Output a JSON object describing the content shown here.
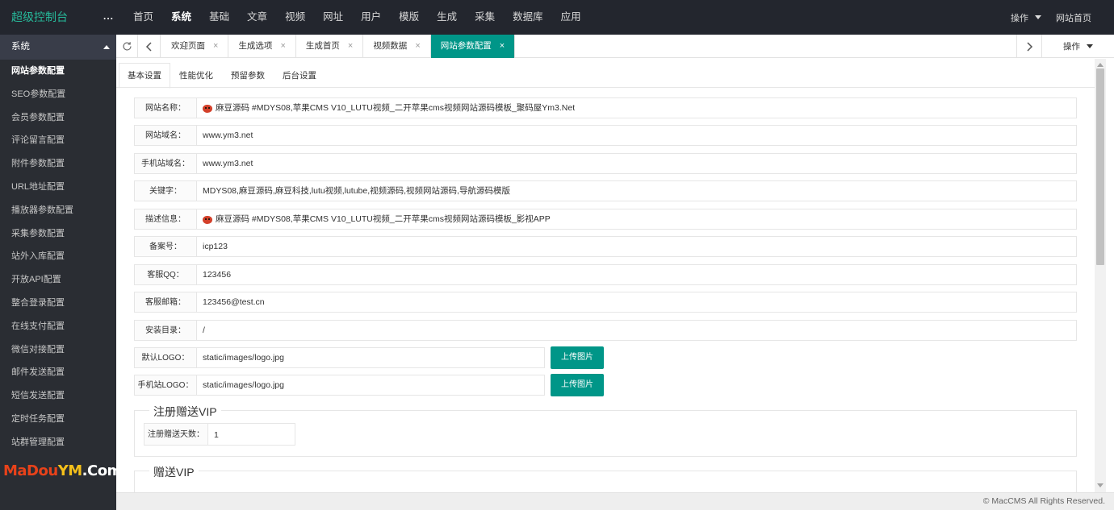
{
  "app": {
    "logo": "超级控制台",
    "menu_toggle": "...",
    "site_home": "网站首页",
    "operate": "操作"
  },
  "topnav": [
    "首页",
    "系统",
    "基础",
    "文章",
    "视频",
    "网址",
    "用户",
    "模版",
    "生成",
    "采集",
    "数据库",
    "应用"
  ],
  "sidebar": {
    "header": "系统",
    "items": [
      "网站参数配置",
      "SEO参数配置",
      "会员参数配置",
      "评论留言配置",
      "附件参数配置",
      "URL地址配置",
      "播放器参数配置",
      "采集参数配置",
      "站外入库配置",
      "开放API配置",
      "整合登录配置",
      "在线支付配置",
      "微信对接配置",
      "邮件发送配置",
      "短信发送配置",
      "定时任务配置",
      "站群管理配置"
    ]
  },
  "watermark": {
    "part1": "MaDou",
    "part2": "YM",
    "part3": ".Com"
  },
  "tabs": {
    "items": [
      "欢迎页面",
      "生成选项",
      "生成首页",
      "视频数据",
      "网站参数配置"
    ],
    "close": "×",
    "operate": "操作"
  },
  "subtabs": [
    "基本设置",
    "性能优化",
    "预留参数",
    "后台设置"
  ],
  "form": {
    "site_name": {
      "label": "网站名称：",
      "value": "麻豆源码 #MDYS08,苹果CMS V10_LUTU视频_二开苹果cms视频网站源码模板_聚码屋Ym3.Net"
    },
    "site_domain": {
      "label": "网站域名：",
      "value": "www.ym3.net"
    },
    "mobile_domain": {
      "label": "手机站域名：",
      "value": "www.ym3.net"
    },
    "keywords": {
      "label": "关键字：",
      "value": "MDYS08,麻豆源码,麻豆科技,lutu视频,lutube,视频源码,视频网站源码,导航源码模版"
    },
    "description": {
      "label": "描述信息：",
      "value": "麻豆源码 #MDYS08,苹果CMS V10_LUTU视频_二开苹果cms视频网站源码模板_影视APP"
    },
    "icp": {
      "label": "备案号：",
      "value": "icp123"
    },
    "qq": {
      "label": "客服QQ：",
      "value": "123456"
    },
    "email": {
      "label": "客服邮箱：",
      "value": "123456@test.cn"
    },
    "install_dir": {
      "label": "安装目录：",
      "value": "/"
    },
    "logo": {
      "label": "默认LOGO：",
      "value": "static/images/logo.jpg",
      "button": "上传图片"
    },
    "mobile_logo": {
      "label": "手机站LOGO：",
      "value": "static/images/logo.jpg",
      "button": "上传图片"
    }
  },
  "reg_vip": {
    "legend": "注册赠送VIP",
    "days_label": "注册赠送天数：",
    "days_value": "1"
  },
  "gift_vip": {
    "legend": "赠送VIP"
  },
  "footer": "© MacCMS All Rights Reserved.",
  "colors": {
    "accent": "#009688",
    "topbar": "#23262e",
    "sidebar": "#2a2d33",
    "logo": "#26b99a"
  }
}
